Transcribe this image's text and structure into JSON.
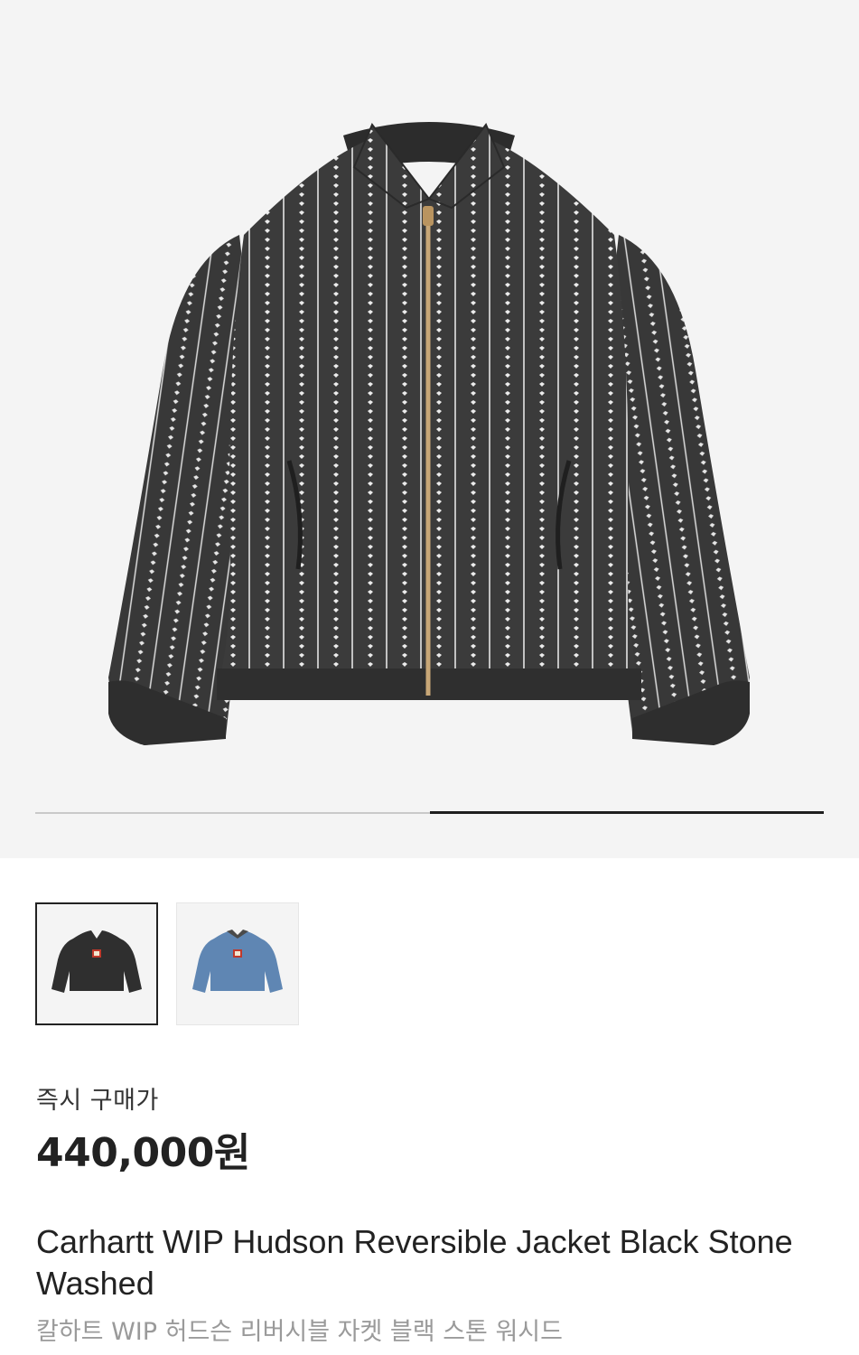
{
  "product": {
    "image_icon": "jacket-image",
    "price_label": "즉시 구매가",
    "price_value": "440,000원",
    "title_en": "Carhartt WIP Hudson Reversible Jacket Black Stone Washed",
    "title_ko": "칼하트 WIP 허드슨 리버시블 자켓 블랙 스톤 워시드"
  },
  "gallery": {
    "slide_index": 2,
    "slide_count": 2,
    "indicator_colors": {
      "track": "#c9c9c9",
      "fill": "#1e1e1e"
    }
  },
  "variants": [
    {
      "name": "black-stone-washed",
      "color": "#2f2f2f",
      "selected": true
    },
    {
      "name": "blue-stone-washed",
      "color": "#5f86b3",
      "selected": false
    }
  ],
  "colors": {
    "hero_background": "#f4f4f4",
    "jacket_body": "#3b3b3b",
    "stripe": "#e8e8e8",
    "zipper": "#c8a777"
  }
}
